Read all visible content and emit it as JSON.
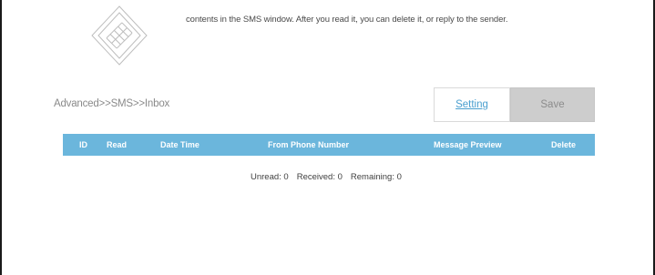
{
  "intro": {
    "text": "contents in the SMS window. After you read it, you can delete it, or reply to the sender."
  },
  "breadcrumb": "Advanced>>SMS>>Inbox",
  "toolbar": {
    "setting_label": "Setting",
    "save_label": "Save"
  },
  "inbox_table": {
    "columns": [
      "ID",
      "Read",
      "Date Time",
      "From Phone Number",
      "Message Preview",
      "Delete"
    ],
    "rows": []
  },
  "counts": {
    "unread": "Unread: 0",
    "received": "Received: 0",
    "remaining": "Remaining: 0"
  },
  "colors": {
    "table_header": "#6bb6dc",
    "link": "#4a9fcf",
    "save_button": "#cdcdcd"
  }
}
